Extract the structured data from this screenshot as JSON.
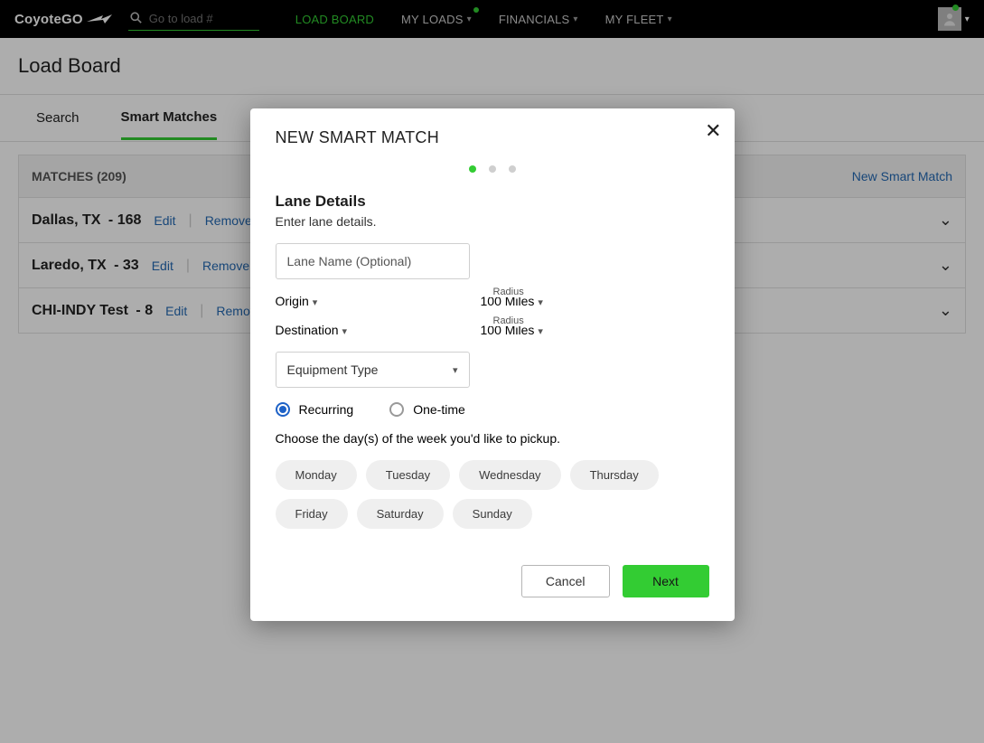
{
  "header": {
    "logo": "CoyoteGO",
    "search_placeholder": "Go to load #",
    "nav": [
      "LOAD BOARD",
      "MY LOADS",
      "FINANCIALS",
      "MY FLEET"
    ],
    "active_nav_index": 0,
    "dot_nav_indexes": [
      1
    ]
  },
  "page": {
    "title": "Load Board",
    "tabs": [
      "Search",
      "Smart Matches"
    ],
    "active_tab_index": 1
  },
  "matches": {
    "heading": "MATCHES (209)",
    "new_link": "New Smart Match",
    "edit_label": "Edit",
    "remove_label": "Remove",
    "rows": [
      {
        "title": "Dallas, TX",
        "count": "168"
      },
      {
        "title": "Laredo, TX",
        "count": "33"
      },
      {
        "title": "CHI-INDY Test",
        "count": "8"
      }
    ]
  },
  "modal": {
    "title": "NEW SMART MATCH",
    "section_title": "Lane Details",
    "section_sub": "Enter lane details.",
    "lane_name_placeholder": "Lane Name (Optional)",
    "origin_label": "Origin",
    "dest_label": "Destination",
    "radius_label": "Radius",
    "radius_value": "100 Miles",
    "equipment_label": "Equipment Type",
    "recurring_label": "Recurring",
    "onetime_label": "One-time",
    "pickup_text": "Choose the day(s) of the week you'd like to pickup.",
    "days": [
      "Monday",
      "Tuesday",
      "Wednesday",
      "Thursday",
      "Friday",
      "Saturday",
      "Sunday"
    ],
    "cancel_label": "Cancel",
    "next_label": "Next"
  }
}
